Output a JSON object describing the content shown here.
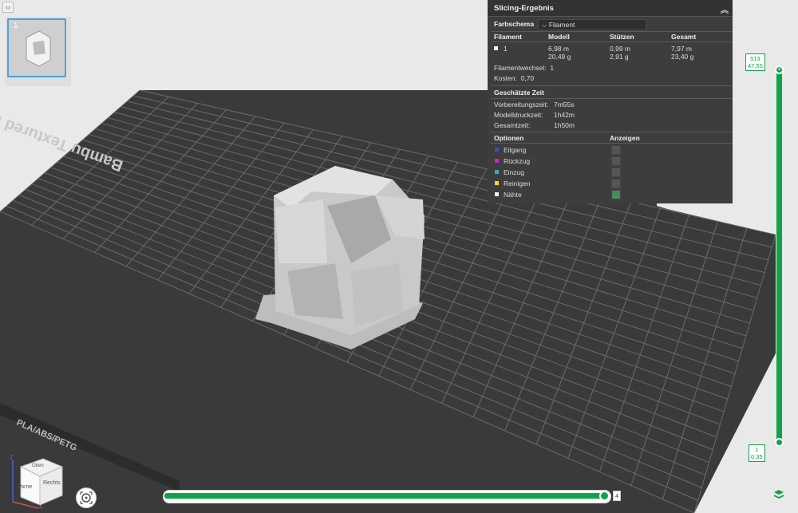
{
  "panel": {
    "title": "Slicing-Ergebnis",
    "color_scheme_label": "Farbschema",
    "color_scheme_value": "Filament",
    "table_headers": [
      "Filament",
      "Modell",
      "Stützen",
      "Gesamt"
    ],
    "row": {
      "filament": "1",
      "model_length": "6,98 m",
      "model_weight": "20,49 g",
      "support_length": "0,99 m",
      "support_weight": "2,91 g",
      "total_length": "7,97 m",
      "total_weight": "23,40 g"
    },
    "filament_changes_label": "Filamentwechsel:",
    "filament_changes_value": "1",
    "cost_label": "Kosten:",
    "cost_value": "0,70",
    "time_section": "Geschätzte Zeit",
    "prep_label": "Vorbereitungszeit:",
    "prep_value": "7m55s",
    "model_time_label": "Modelldruckzeit:",
    "model_time_value": "1h42m",
    "total_time_label": "Gesamtzeit:",
    "total_time_value": "1h50m",
    "options_header": "Optionen",
    "show_header": "Anzeigen",
    "options": [
      {
        "label": "Eilgang",
        "color": "#3b4fb8",
        "shown": false
      },
      {
        "label": "Rückzug",
        "color": "#d020d0",
        "shown": false
      },
      {
        "label": "Einzug",
        "color": "#40a8c8",
        "shown": false
      },
      {
        "label": "Reinigen",
        "color": "#f0e020",
        "shown": false
      },
      {
        "label": "Nähte",
        "color": "#f0f0f0",
        "shown": true
      }
    ]
  },
  "plate": {
    "name": "Bambu Textured PEI Plate",
    "filament_types": "PLA/ABS/PETG"
  },
  "thumbnail": {
    "index": "1"
  },
  "layer_slider": {
    "top_layer": "513",
    "top_height": "47,55",
    "bottom_layer": "1",
    "bottom_height": "0,35"
  },
  "move_slider": {
    "value": "4"
  },
  "view_cube": {
    "front": "Vorne",
    "right": "Rechts",
    "top": "Oben",
    "axis_z": "Z",
    "axis_x": "X"
  },
  "toggle": {
    "glyph": "‹›"
  },
  "colors": {
    "accent": "#11a34a",
    "panel_bg": "#3d3d3d",
    "bed": "#3a3a3a"
  }
}
